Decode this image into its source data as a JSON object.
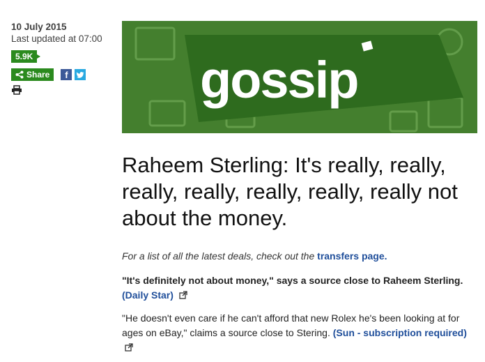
{
  "meta": {
    "date": "10 July 2015",
    "updated": "Last updated at 07:00",
    "share_count": "5.9K",
    "share_label": "Share"
  },
  "banner": {
    "wordmark": "gossip"
  },
  "article": {
    "headline": "Raheem Sterling: It's really, really, really, really, really, really, really not about the money.",
    "intro_text": "For a list of all the latest deals, check out the",
    "intro_link": "transfers page.",
    "p1_text": "\"It's definitely not about money,\" says a source close to Raheem Sterling.",
    "p1_source": "(Daily Star)",
    "p2_text": "\"He doesn't even care if he can't afford that new Rolex he's been looking at for ages on eBay,\" claims a source close to Stering.",
    "p2_source": "(Sun - subscription required)"
  },
  "icons": {
    "share": "share-icon",
    "facebook": "facebook-icon",
    "twitter": "twitter-icon",
    "print": "print-icon",
    "external": "external-link-icon"
  },
  "colors": {
    "brand_green": "#2b8a1e",
    "banner_green": "#3f7a2c",
    "link_blue": "#1f4e9a",
    "facebook": "#3b5998",
    "twitter": "#29a9e1"
  }
}
